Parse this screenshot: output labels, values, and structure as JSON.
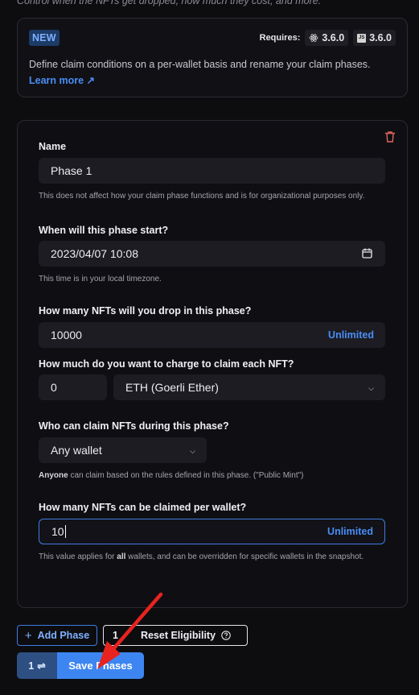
{
  "header_cut_text": "Control when the NFTs get dropped, how much they cost, and more.",
  "notice": {
    "badge": "NEW",
    "requires_label": "Requires:",
    "react_version": "3.6.0",
    "js_icon_text": "JS",
    "js_version": "3.6.0",
    "text": "Define claim conditions on a per-wallet basis and rename your claim phases.",
    "learn_more": "Learn more ↗"
  },
  "phase": {
    "name_label": "Name",
    "name_value": "Phase 1",
    "name_help": "This does not affect how your claim phase functions and is for organizational purposes only.",
    "start_label": "When will this phase start?",
    "start_value": "2023/04/07 10:08",
    "start_help": "This time is in your local timezone.",
    "drop_label": "How many NFTs will you drop in this phase?",
    "drop_value": "10000",
    "drop_unlimited": "Unlimited",
    "price_label": "How much do you want to charge to claim each NFT?",
    "price_value": "0",
    "currency_value": "ETH (Goerli Ether)",
    "who_label": "Who can claim NFTs during this phase?",
    "who_value": "Any wallet",
    "who_help_bold": "Anyone",
    "who_help_rest": " can claim based on the rules defined in this phase. (\"Public Mint\")",
    "per_wallet_label": "How many NFTs can be claimed per wallet?",
    "per_wallet_value": "10",
    "per_wallet_unlimited": "Unlimited",
    "per_wallet_help_1": "This value applies for ",
    "per_wallet_help_bold": "all",
    "per_wallet_help_2": " wallets, and can be overridden for specific wallets in the snapshot."
  },
  "actions": {
    "add_phase": "Add Phase",
    "reset_prefix": "1",
    "reset_label": "Reset Eligibility",
    "save_count": "1",
    "save_label": "Save Phases"
  },
  "colors": {
    "accent": "#3d86f2",
    "annotation_arrow": "#e8231f"
  }
}
